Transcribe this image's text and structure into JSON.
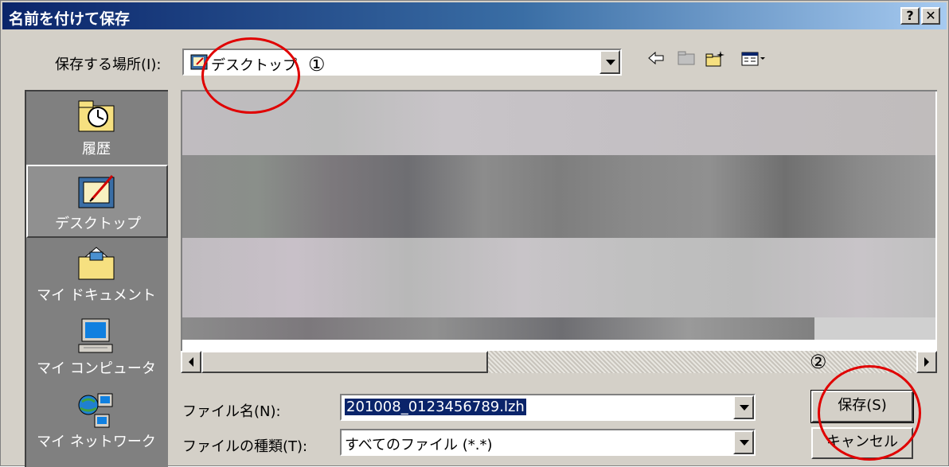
{
  "window": {
    "title": "名前を付けて保存",
    "help_label": "?",
    "close_label": "✕"
  },
  "location": {
    "label": "保存する場所(I):",
    "value": "デスクトップ",
    "marker": "①"
  },
  "toolbar": {
    "back_icon": "back-arrow-icon",
    "up_icon": "up-folder-icon",
    "new_folder_icon": "new-folder-icon",
    "view_menu_icon": "view-menu-icon"
  },
  "places": [
    {
      "label": "履歴",
      "icon": "history-icon"
    },
    {
      "label": "デスクトップ",
      "icon": "desktop-icon",
      "active": true
    },
    {
      "label": "マイ ドキュメント",
      "icon": "my-documents-icon"
    },
    {
      "label": "マイ コンピュータ",
      "icon": "my-computer-icon"
    },
    {
      "label": "マイ ネットワーク",
      "icon": "my-network-icon"
    }
  ],
  "filename": {
    "label": "ファイル名(N):",
    "value": "201008_0123456789.lzh"
  },
  "filetype": {
    "label": "ファイルの種類(T):",
    "value": "すべてのファイル (*.*)"
  },
  "buttons": {
    "save": "保存(S)",
    "cancel": "キャンセル",
    "marker": "②"
  },
  "colors": {
    "annotation": "#e00000",
    "titlebar_start": "#0a246a",
    "selection": "#0a246a",
    "dialog_bg": "#d4d0c8"
  }
}
